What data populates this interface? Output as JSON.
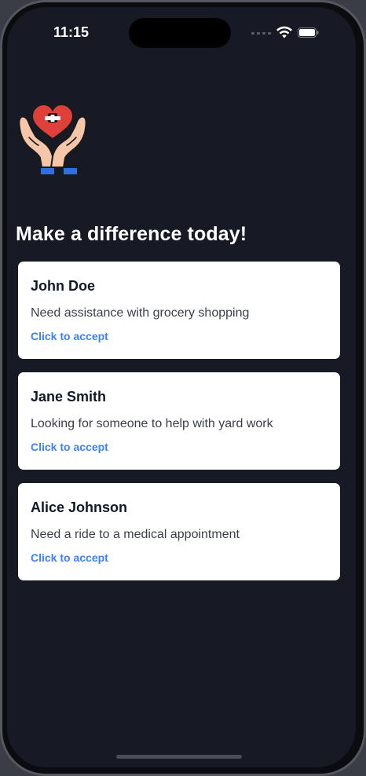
{
  "status_bar": {
    "time": "11:15",
    "signal_icon": "cellular-signal-icon",
    "wifi_icon": "wifi-icon",
    "battery_icon": "battery-icon"
  },
  "logo": {
    "icon": "hands-holding-heart-icon"
  },
  "page": {
    "title": "Make a difference today!"
  },
  "requests": [
    {
      "name": "John Doe",
      "description": "Need assistance with grocery shopping",
      "action_label": "Click to accept"
    },
    {
      "name": "Jane Smith",
      "description": "Looking for someone to help with yard work",
      "action_label": "Click to accept"
    },
    {
      "name": "Alice Johnson",
      "description": "Need a ride to a medical appointment",
      "action_label": "Click to accept"
    }
  ],
  "colors": {
    "background": "#171924",
    "card": "#ffffff",
    "accent": "#3b82f6",
    "heart": "#e0403a"
  }
}
